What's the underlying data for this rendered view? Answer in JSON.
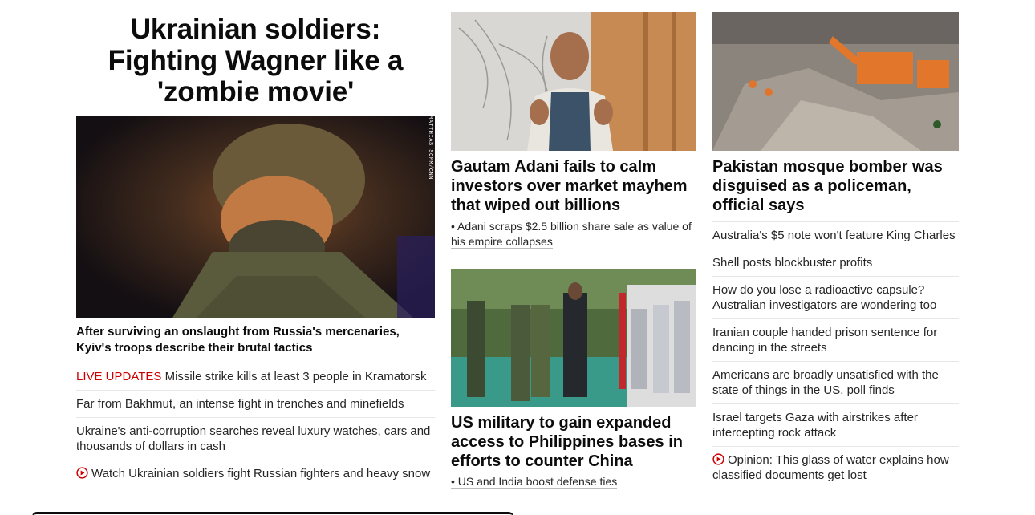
{
  "lead": {
    "title": "Ukrainian soldiers: Fighting Wagner like a 'zombie movie'",
    "image_credit": "MATTHIAS SOMM/CNN",
    "subhead": "After surviving an onslaught from Russia's mercenaries, Kyiv's troops describe their brutal tactics",
    "links": [
      {
        "prefix": "LIVE UPDATES",
        "text": " Missile strike kills at least 3 people in Kramatorsk"
      },
      {
        "prefix": "",
        "text": "Far from Bakhmut, an intense fight in trenches and minefields"
      },
      {
        "prefix": "",
        "text": "Ukraine's anti-corruption searches reveal luxury watches, cars and thousands of dollars in cash"
      },
      {
        "prefix": "",
        "text": "Watch Ukrainian soldiers fight Russian fighters and heavy snow",
        "icon": "play-circle-icon"
      }
    ]
  },
  "adani": {
    "headline": "Gautam Adani fails to calm investors over market mayhem that wiped out billions",
    "bullet": "• Adani scraps $2.5 billion share sale as value of his empire collapses"
  },
  "military": {
    "headline": "US military to gain expanded access to Philippines bases in efforts to counter China",
    "bullet": "• US and India boost defense ties"
  },
  "pakistan": {
    "headline": "Pakistan mosque bomber was disguised as a policeman, official says",
    "links": [
      {
        "text": "Australia's $5 note won't feature King Charles"
      },
      {
        "text": "Shell posts blockbuster profits"
      },
      {
        "text": "How do you lose a radioactive capsule? Australian investigators are wondering too"
      },
      {
        "text": "Iranian couple handed prison sentence for dancing in the streets"
      },
      {
        "text": "Americans are broadly unsatisfied with the state of things in the US, poll finds"
      },
      {
        "text": "Israel targets Gaza with airstrikes after intercepting rock attack"
      },
      {
        "text": "Opinion: This glass of water explains how classified documents get lost",
        "icon": "play-circle-icon"
      }
    ]
  },
  "colors": {
    "live": "#cc0000",
    "text": "#0c0c0c",
    "divider": "#e6e6e6"
  }
}
